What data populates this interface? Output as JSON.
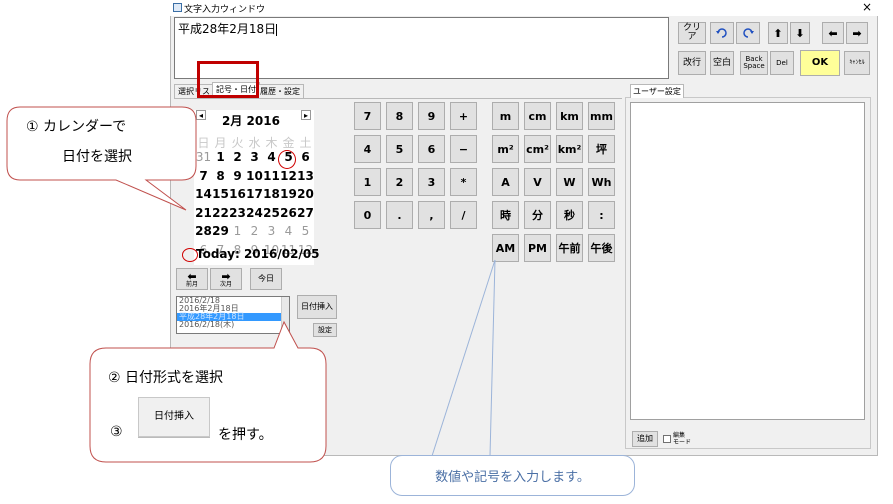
{
  "window": {
    "title": "文字入力ウィンドウ",
    "close": "×"
  },
  "textarea": {
    "value": "平成28年2月18日"
  },
  "toolbar": {
    "clear": "クリア",
    "undo_icon": "undo-icon",
    "redo_icon": "redo-icon",
    "up": "⬆",
    "down": "⬇",
    "left": "⬅",
    "right": "➡",
    "newline": "改行",
    "space": "空白",
    "backspace": "Back\nSpace",
    "del": "Del",
    "ok": "OK",
    "cancel": "ｷｬﾝｾﾙ"
  },
  "tabs": [
    "選択リスト",
    "記号・日付",
    "履歴・設定"
  ],
  "user_tab": "ユーザー設定",
  "calendar": {
    "prev": "◂",
    "next": "▸",
    "title": "2月 2016",
    "weekdays": [
      "日",
      "月",
      "火",
      "水",
      "木",
      "金",
      "土"
    ],
    "rows": [
      [
        "31",
        "1",
        "2",
        "3",
        "4",
        "5",
        "6"
      ],
      [
        "7",
        "8",
        "9",
        "10",
        "11",
        "12",
        "13"
      ],
      [
        "14",
        "15",
        "16",
        "17",
        "18",
        "19",
        "20"
      ],
      [
        "21",
        "22",
        "23",
        "24",
        "25",
        "26",
        "27"
      ],
      [
        "28",
        "29",
        "1",
        "2",
        "3",
        "4",
        "5"
      ],
      [
        "6",
        "7",
        "8",
        "9",
        "10",
        "11",
        "12"
      ]
    ],
    "today": "Today: 2016/02/05",
    "prev_month_label": "前月",
    "next_month_label": "次月",
    "today_button": "今日"
  },
  "date_list": {
    "items": [
      "2016/2/18",
      "2016年2月18日",
      "平成28年2月18日",
      "2016/2/18(木)"
    ],
    "selected": 2
  },
  "date_buttons": {
    "insert": "日付挿入",
    "settings": "設定"
  },
  "numpad": [
    [
      "7",
      "8",
      "9",
      "+"
    ],
    [
      "4",
      "5",
      "6",
      "−"
    ],
    [
      "1",
      "2",
      "3",
      "*"
    ],
    [
      "0",
      ".",
      ",",
      "/"
    ]
  ],
  "symbols": [
    [
      "m",
      "cm",
      "km",
      "mm"
    ],
    [
      "m²",
      "cm²",
      "km²",
      "坪"
    ],
    [
      "A",
      "V",
      "W",
      "Wh"
    ],
    [
      "時",
      "分",
      "秒",
      ":"
    ],
    [
      "AM",
      "PM",
      "午前",
      "午後"
    ]
  ],
  "user_panel": {
    "add": "追加",
    "edit_mode": "編集\nモード"
  },
  "callouts": {
    "c1_line1": "① カレンダーで",
    "c1_line2": "日付を選択",
    "c2_line1": "② 日付形式を選択",
    "c3_prefix": "③",
    "c3_button": "日付挿入",
    "c3_suffix": "を押す。",
    "c4": "数値や記号を入力します。"
  },
  "colors": {
    "highlight_red": "#c00000",
    "selection_blue": "#3399ff",
    "ok_yellow": "#ffff99",
    "callout_blue": "#9cb4d9"
  }
}
